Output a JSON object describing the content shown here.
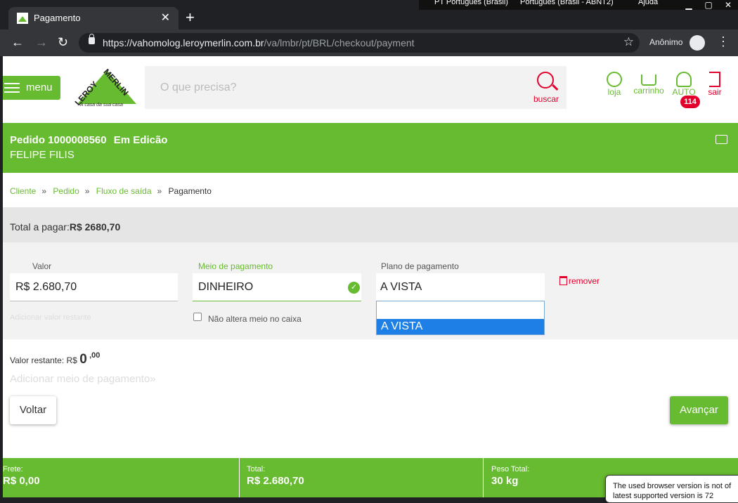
{
  "system": {
    "lang": "PT Português (Brasil)",
    "keyboard": "Português (Brasil - ABNT2)",
    "help": "Ajuda"
  },
  "browser": {
    "tab_title": "Pagamento",
    "url_main": "https://vahomolog.leroymerlin.com.br",
    "url_path": "/va/lmbr/pt/BRL/checkout/payment",
    "profile": "Anônimo"
  },
  "header": {
    "menu_label": "menu",
    "logo_text_1": "LEROY",
    "logo_text_2": "MERLIN",
    "tagline": "A casa da sua casa",
    "search_placeholder": "O que precisa?",
    "search_label": "buscar",
    "loja": "loja",
    "carrinho": "carrinho",
    "user": "AUTO",
    "user_badge": "114",
    "sair": "sair"
  },
  "order": {
    "number": "Pedido 1000008560",
    "status": "Em Edicão",
    "customer": "FELIPE FILIS"
  },
  "breadcrumb": {
    "items": [
      "Cliente",
      "Pedido",
      "Fluxo de saída",
      "Pagamento"
    ],
    "separator": "»"
  },
  "total": {
    "label": "Total a pagar:",
    "value": "R$ 2680,70"
  },
  "form": {
    "valor_label": "Valor",
    "valor_value": "R$  2.680,70",
    "adicionar_restante": "Adicionar valor restante",
    "meio_label": "Meio de pagamento",
    "meio_value": "DINHEIRO",
    "nao_altera": "Não altera meio no caixa",
    "plano_label": "Plano de pagamento",
    "plano_value": "A VISTA",
    "plano_option": "A VISTA",
    "remover": "remover"
  },
  "restante": {
    "label": "Valor restante:",
    "currency": "R$",
    "value": "0",
    "cents": ",00"
  },
  "add_payment": "Adicionar meio de pagamento»",
  "buttons": {
    "voltar": "Voltar",
    "avancar": "Avançar"
  },
  "footer": {
    "frete_label": "Frete:",
    "frete_value": "R$ 0,00",
    "total_label": "Total:",
    "total_value": "R$ 2.680,70",
    "peso_label": "Peso Total:",
    "peso_value": "30  kg"
  },
  "toast": {
    "line1": "The used browser version is not of",
    "line2": "latest supported version is 72"
  },
  "colors": {
    "brand_green": "#67bb30",
    "alert_red": "#e3002b",
    "select_blue": "#1e80e7"
  }
}
